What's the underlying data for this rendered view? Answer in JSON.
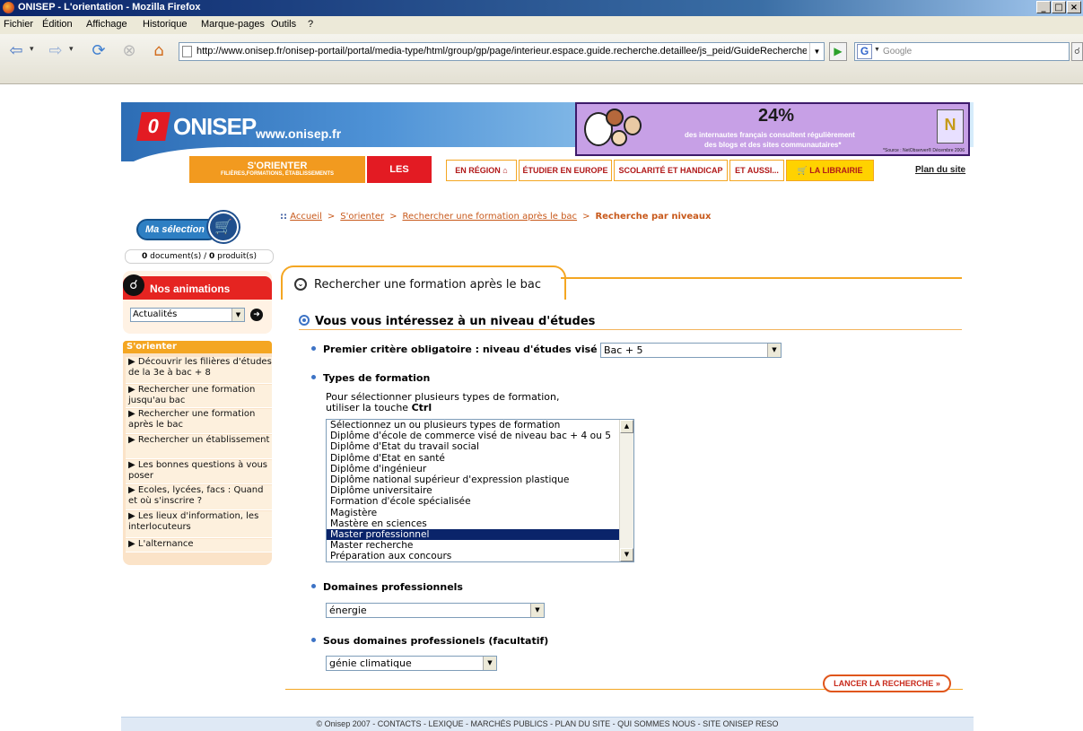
{
  "window": {
    "title": "ONISEP - L'orientation - Mozilla Firefox",
    "buttons": [
      "_",
      "□",
      "×"
    ]
  },
  "menubar": [
    "Fichier",
    "Édition",
    "Affichage",
    "Historique",
    "Marque-pages",
    "Outils",
    "?"
  ],
  "navbar": {
    "url": "http://www.onisep.fr/onisep-portail/portal/media-type/html/group/gp/page/interieur.espace.guide.recherche.detaillee/js_peid/GuideRechercheDetail",
    "search_placeholder": "Google",
    "search_engine": "G"
  },
  "header": {
    "logo_mark": "0",
    "logo_text": "ONISEP",
    "site_url": "www.onisep.fr",
    "banner": {
      "percent": "24%",
      "line1": "des internautes français consultent régulièrement",
      "line2": "des blogs et des sites communautaires*",
      "source": "*Source : NetObserver® Décembre 2006"
    },
    "nav": {
      "sorienter_big": "S'ORIENTER",
      "sorienter_small": "FILIÈRES,FORMATIONS, ÉTABLISSEMENTS",
      "metiers": "LES MÉTIERS",
      "region": "EN RÉGION",
      "europe": "ÉTUDIER EN EUROPE",
      "handicap": "SCOLARITÉ ET HANDICAP",
      "aussi": "ET AUSSI...",
      "librairie": "LA LIBRAIRIE"
    },
    "plan_du_site": "Plan du site"
  },
  "sidebar": {
    "ma_selection": "Ma sélection",
    "count_docs": "0",
    "count_docs_label": "document(s) / ",
    "count_products": "0",
    "count_products_label": "produit(s)",
    "animations_title": "Nos animations",
    "animations_select": "Actualités",
    "sorienter_title": "S'orienter",
    "links": [
      "Découvrir les filières d'études de la 3e à bac + 8",
      "Rechercher une formation jusqu'au bac",
      "Rechercher une formation après le bac",
      "Rechercher un établissement",
      "Les bonnes questions à vous poser",
      "Ecoles, lycées, facs : Quand et où s'inscrire ?",
      "Les lieux d'information, les interlocuteurs",
      "L'alternance"
    ]
  },
  "breadcrumb": {
    "prefix": "::",
    "items": [
      "Accueil",
      "S'orienter",
      "Rechercher une formation après le bac"
    ],
    "current": "Recherche par niveaux",
    "separator": ">"
  },
  "panel": {
    "title": "Rechercher une formation après le bac",
    "section_title": "Vous vous intéressez à un niveau d'études",
    "niveau_label": "Premier critère obligatoire : niveau d'études visé",
    "niveau_value": "Bac + 5",
    "types_label": "Types de formation",
    "types_help_1": "Pour sélectionner plusieurs types de formation,",
    "types_help_2": "utiliser la touche ",
    "types_help_key": "Ctrl",
    "types_options": [
      "Sélectionnez un ou plusieurs types de formation",
      "Diplôme d'école de commerce visé de niveau bac + 4 ou 5",
      "Diplôme d'Etat du travail social",
      "Diplôme d'Etat en santé",
      "Diplôme d'ingénieur",
      "Diplôme national supérieur d'expression plastique",
      "Diplôme universitaire",
      "Formation d'école spécialisée",
      "Magistère",
      "Mastère en sciences",
      "Master professionnel",
      "Master recherche",
      "Préparation aux concours"
    ],
    "types_selected": "Master professionnel",
    "domaines_label": "Domaines professionnels",
    "domaines_value": "énergie",
    "sous_domaines_label": "Sous domaines professionels (facultatif)",
    "sous_domaines_value": "génie climatique",
    "launch_button": "LANCER LA RECHERCHE"
  },
  "footer": "© Onisep 2007 - CONTACTS - LEXIQUE - MARCHÉS PUBLICS - PLAN DU SITE - QUI SOMMES NOUS - SITE ONISEP RESO",
  "colors": {
    "accent_orange": "#f4a622",
    "onisep_red": "#e31b23",
    "link_orange": "#c8591b",
    "bullet_blue": "#3d73c5",
    "selection_navy": "#0a246a"
  }
}
